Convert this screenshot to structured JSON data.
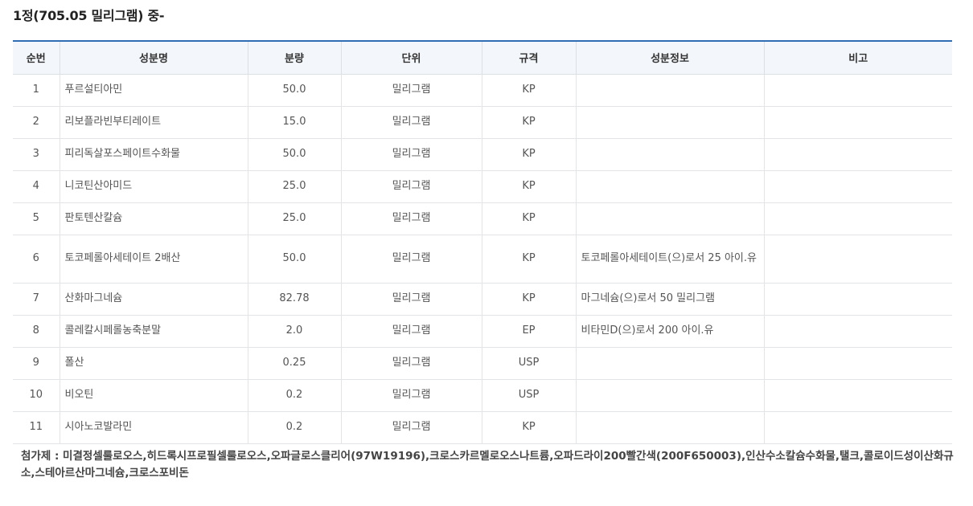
{
  "title": "1정(705.05 밀리그램) 중-",
  "columns": [
    "순번",
    "성분명",
    "분량",
    "단위",
    "규격",
    "성분정보",
    "비고"
  ],
  "rows": [
    {
      "no": "1",
      "name": "푸르설티아민",
      "amount": "50.0",
      "unit": "밀리그램",
      "spec": "KP",
      "info": "",
      "note": ""
    },
    {
      "no": "2",
      "name": "리보플라빈부티레이트",
      "amount": "15.0",
      "unit": "밀리그램",
      "spec": "KP",
      "info": "",
      "note": ""
    },
    {
      "no": "3",
      "name": "피리독살포스페이트수화물",
      "amount": "50.0",
      "unit": "밀리그램",
      "spec": "KP",
      "info": "",
      "note": ""
    },
    {
      "no": "4",
      "name": "니코틴산아미드",
      "amount": "25.0",
      "unit": "밀리그램",
      "spec": "KP",
      "info": "",
      "note": ""
    },
    {
      "no": "5",
      "name": "판토텐산칼슘",
      "amount": "25.0",
      "unit": "밀리그램",
      "spec": "KP",
      "info": "",
      "note": ""
    },
    {
      "no": "6",
      "name": "토코페롤아세테이트 2배산",
      "amount": "50.0",
      "unit": "밀리그램",
      "spec": "KP",
      "info": "토코페롤아세테이트(으)로서 25 아이.유",
      "note": ""
    },
    {
      "no": "7",
      "name": "산화마그네슘",
      "amount": "82.78",
      "unit": "밀리그램",
      "spec": "KP",
      "info": "마그네슘(으)로서 50 밀리그램",
      "note": ""
    },
    {
      "no": "8",
      "name": "콜레칼시페롤농축분말",
      "amount": "2.0",
      "unit": "밀리그램",
      "spec": "EP",
      "info": "비타민D(으)로서 200 아이.유",
      "note": ""
    },
    {
      "no": "9",
      "name": "폴산",
      "amount": "0.25",
      "unit": "밀리그램",
      "spec": "USP",
      "info": "",
      "note": ""
    },
    {
      "no": "10",
      "name": "비오틴",
      "amount": "0.2",
      "unit": "밀리그램",
      "spec": "USP",
      "info": "",
      "note": ""
    },
    {
      "no": "11",
      "name": "시아노코발라민",
      "amount": "0.2",
      "unit": "밀리그램",
      "spec": "KP",
      "info": "",
      "note": ""
    }
  ],
  "additives": "첨가제 : 미결정셀룰로오스,히드록시프로필셀룰로오스,오파글로스클리어(97W19196),크로스카르멜로오스나트륨,오파드라이200빨간색(200F650003),인산수소칼슘수화물,탤크,콜로이드성이산화규소,스테아르산마그네슘,크로스포비돈",
  "colors": {
    "header_bg": "#f3f6fa",
    "top_border": "#2f6db5",
    "grid": "#e2e4e8"
  }
}
